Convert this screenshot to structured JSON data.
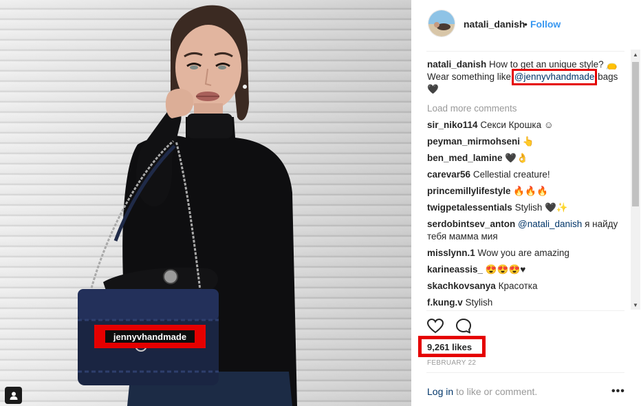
{
  "post": {
    "tag_label": "jennyvhandmade",
    "user_tag_icon": "person-icon"
  },
  "header": {
    "username": "natali_danish",
    "separator": "•",
    "follow_label": "Follow"
  },
  "caption": {
    "username": "natali_danish",
    "text_before": "How to get an unique style? 👝 Wear something like",
    "mention": "@jennyvhandmade",
    "text_after": "bags 🖤"
  },
  "load_more": "Load more comments",
  "comments": [
    {
      "user": "sir_niko114",
      "text": "Секси Крошка ☺"
    },
    {
      "user": "peyman_mirmohseni",
      "text": "👆"
    },
    {
      "user": "ben_med_lamine",
      "text": "🖤👌"
    },
    {
      "user": "carevar56",
      "text": "Cellestial creature!"
    },
    {
      "user": "princemillylifestyle",
      "text": "🔥🔥🔥"
    },
    {
      "user": "twigpetalessentials",
      "text": "Stylish 🖤✨"
    },
    {
      "user": "serdobintsev_anton",
      "mention": "@natali_danish",
      "text": "я найду тебя мамма мия"
    },
    {
      "user": "misslynn.1",
      "text": "Wow you are amazing"
    },
    {
      "user": "karineassis_",
      "text": "😍😍😍♥"
    },
    {
      "user": "skachkovsanya",
      "text": "Красотка"
    },
    {
      "user": "f.kung.v",
      "text": "Stylish"
    }
  ],
  "actions": {
    "like_icon": "heart-icon",
    "comment_icon": "comment-icon"
  },
  "likes": "9,261 likes",
  "date": "FEBRUARY 22",
  "footer": {
    "login_link": "Log in",
    "login_text": "to like or comment.",
    "more_label": "•••"
  },
  "colors": {
    "link": "#003569",
    "follow": "#3897f0",
    "highlight": "#e50000",
    "muted": "#999999"
  }
}
